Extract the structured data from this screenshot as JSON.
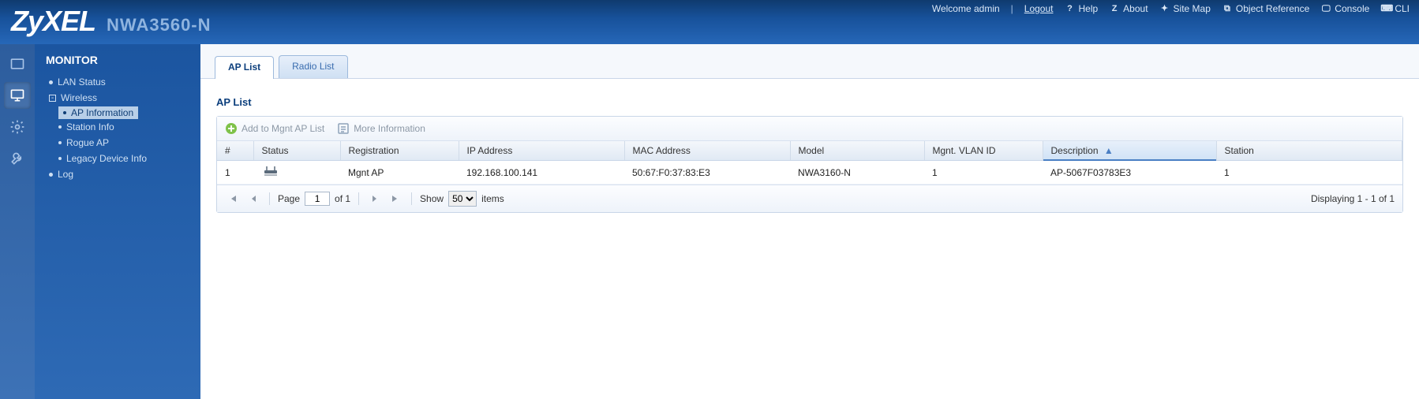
{
  "banner": {
    "brand": "ZyXEL",
    "model": "NWA3560-N",
    "welcome_prefix": "Welcome",
    "username": "admin",
    "logout": "Logout",
    "links": {
      "help": "Help",
      "about": "About",
      "sitemap": "Site Map",
      "objref": "Object Reference",
      "console": "Console",
      "cli": "CLI"
    }
  },
  "sidebar": {
    "title": "MONITOR",
    "items": {
      "lan_status": "LAN Status",
      "wireless": "Wireless",
      "wireless_children": {
        "ap_information": "AP Information",
        "station_info": "Station Info",
        "rogue_ap": "Rogue AP",
        "legacy_device_info": "Legacy Device Info"
      },
      "log": "Log"
    }
  },
  "tabs": {
    "ap_list": "AP List",
    "radio_list": "Radio List"
  },
  "section": {
    "title": "AP List"
  },
  "toolbar": {
    "add_label": "Add to Mgnt AP List",
    "more_label": "More Information"
  },
  "columns": {
    "num": "#",
    "status": "Status",
    "registration": "Registration",
    "ip": "IP Address",
    "mac": "MAC Address",
    "model": "Model",
    "vlan": "Mgnt. VLAN ID",
    "description": "Description",
    "station": "Station"
  },
  "rows": [
    {
      "num": "1",
      "registration": "Mgnt AP",
      "ip": "192.168.100.141",
      "mac": "50:67:F0:37:83:E3",
      "model": "NWA3160-N",
      "vlan": "1",
      "description": "AP-5067F03783E3",
      "station": "1"
    }
  ],
  "pager": {
    "page_label": "Page",
    "page_value": "1",
    "of_label": "of 1",
    "show_label": "Show",
    "show_value": "50",
    "items_label": "items",
    "display_text": "Displaying 1 - 1 of 1"
  },
  "icons": {
    "help": "?",
    "about": "Z",
    "sitemap": "✦",
    "objref": "⧉",
    "console": "🖵",
    "cli": "⌨"
  }
}
